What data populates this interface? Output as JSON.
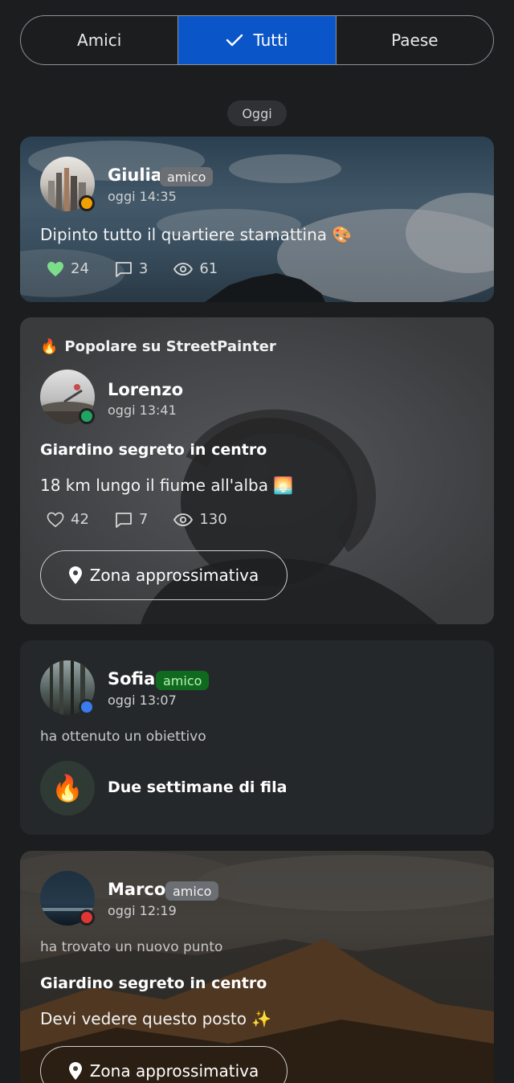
{
  "filter_tabs": [
    {
      "label": "Amici",
      "active": false
    },
    {
      "label": "Tutti",
      "active": true
    },
    {
      "label": "Paese",
      "active": false
    }
  ],
  "date_header": "Oggi",
  "posts": [
    {
      "name": "Giulia",
      "badge": "amico",
      "time": "oggi 14:35",
      "text": "Dipinto tutto il quartiere stamattina 🎨",
      "likes": "24",
      "comments": "3",
      "views": "61",
      "liked": true,
      "status_color": "#f0a000"
    },
    {
      "popular_label": "Popolare su StreetPainter",
      "popular_icon": "🔥",
      "name": "Lorenzo",
      "time": "oggi 13:41",
      "title": "Giardino segreto in centro",
      "text": "18 km lungo il fiume all'alba 🌅",
      "likes": "42",
      "comments": "7",
      "views": "130",
      "liked": false,
      "location_button": "Zona approssimativa",
      "status_color": "#1fa463"
    },
    {
      "name": "Sofia",
      "badge": "amico",
      "time": "oggi 13:07",
      "activity": "ha ottenuto un obiettivo",
      "achievement_icon": "🔥",
      "achievement": "Due settimane di fila",
      "status_color": "#3a7bf0"
    },
    {
      "name": "Marco",
      "badge": "amico",
      "time": "oggi 12:19",
      "activity": "ha trovato un nuovo punto",
      "title": "Giardino segreto in centro",
      "text": "Devi vedere questo posto ✨",
      "location_button": "Zona approssimativa",
      "status_color": "#e03535"
    }
  ],
  "colors": {
    "accent": "#0a56c8",
    "background": "#1c1d1f",
    "like_active": "#7ddc8a"
  }
}
